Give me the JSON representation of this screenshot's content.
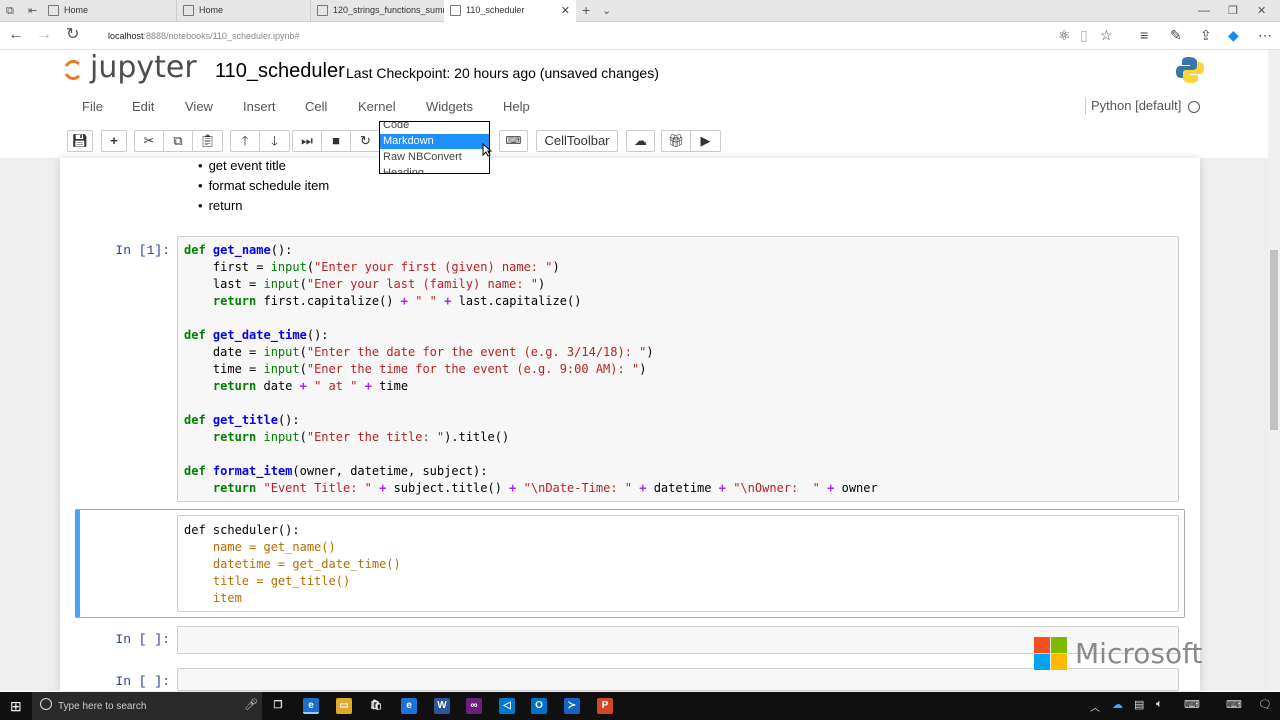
{
  "browser": {
    "tabs": [
      {
        "label": "Home"
      },
      {
        "label": "Home"
      },
      {
        "label": "120_strings_functions_sumn"
      },
      {
        "label": "110_scheduler",
        "active": true
      }
    ],
    "address_host": "localhost",
    "address_path": ":8888/notebooks/110_scheduler.ipynb#"
  },
  "jupyter": {
    "logo_text": "jupyter",
    "notebook_title": "110_scheduler",
    "checkpoint": "Last Checkpoint: 20 hours ago (unsaved changes)",
    "menu": [
      "File",
      "Edit",
      "View",
      "Insert",
      "Cell",
      "Kernel",
      "Widgets",
      "Help"
    ],
    "kernel_label": "Python [default]",
    "celltoolbar_label": "CellToolbar",
    "cell_type_options": [
      {
        "label": "Code",
        "selected": false
      },
      {
        "label": "Markdown",
        "selected": true
      },
      {
        "label": "Raw NBConvert",
        "selected": false
      },
      {
        "label": "Heading",
        "selected": false
      }
    ]
  },
  "notebook": {
    "markdown_bullets": [
      "get event title",
      "format schedule item",
      "return"
    ],
    "cell1_prompt": "In [1]:",
    "empty_prompt_1": "In [ ]:",
    "empty_prompt_2": "In [ ]:"
  },
  "watermark": {
    "text": "Microsoft",
    "colors": [
      "#f25022",
      "#7fba00",
      "#00a4ef",
      "#ffb900"
    ]
  },
  "taskbar": {
    "search_placeholder": "Type here to search"
  }
}
